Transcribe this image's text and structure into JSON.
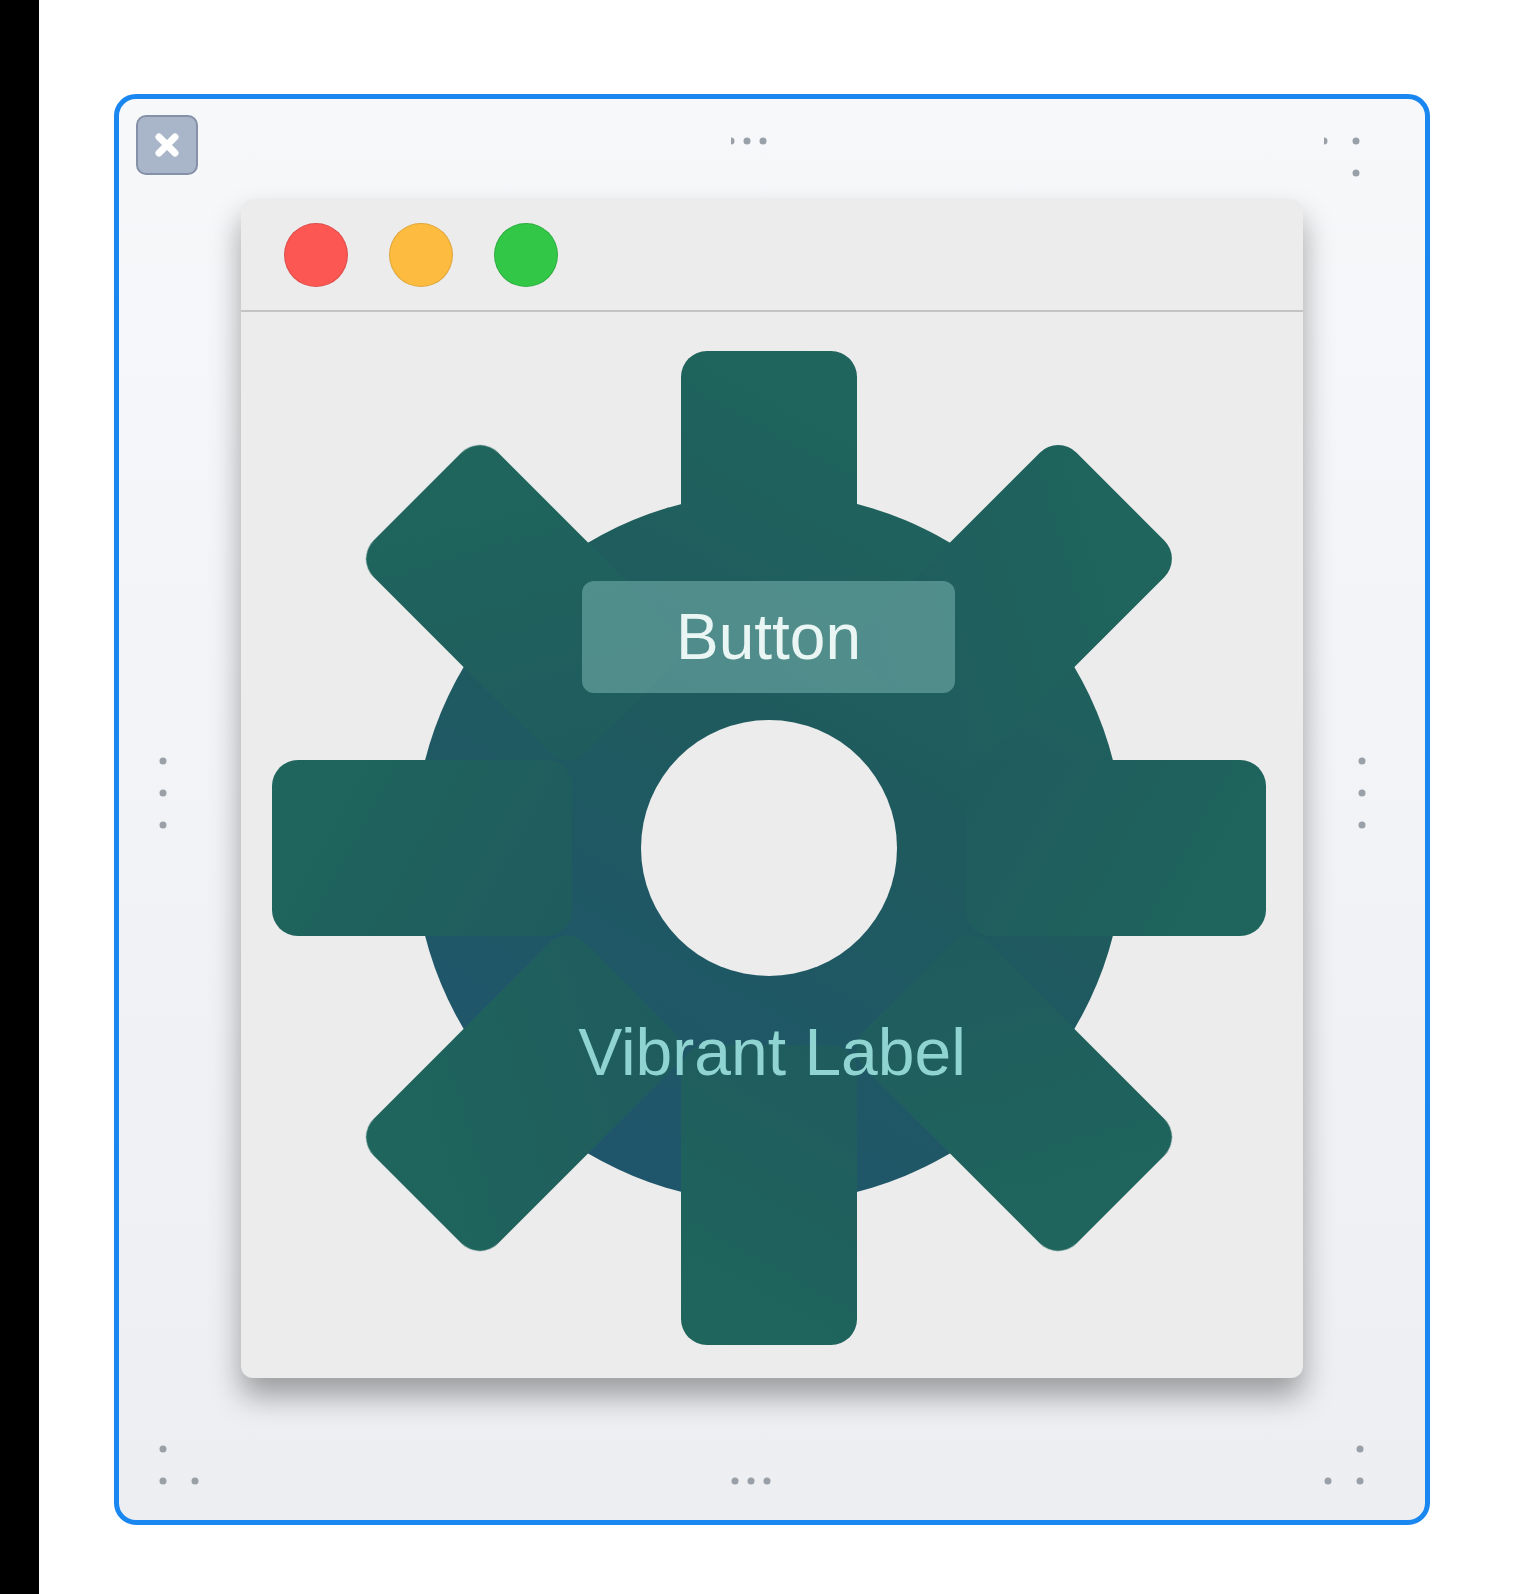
{
  "selection_frame": {
    "close_button": {
      "kind": "close"
    }
  },
  "window": {
    "controls": [
      {
        "color": "#fc5753"
      },
      {
        "color": "#fdbc40"
      },
      {
        "color": "#33c748"
      }
    ]
  },
  "content": {
    "button": {
      "label": "Button"
    },
    "label": {
      "text": "Vibrant Label"
    }
  }
}
